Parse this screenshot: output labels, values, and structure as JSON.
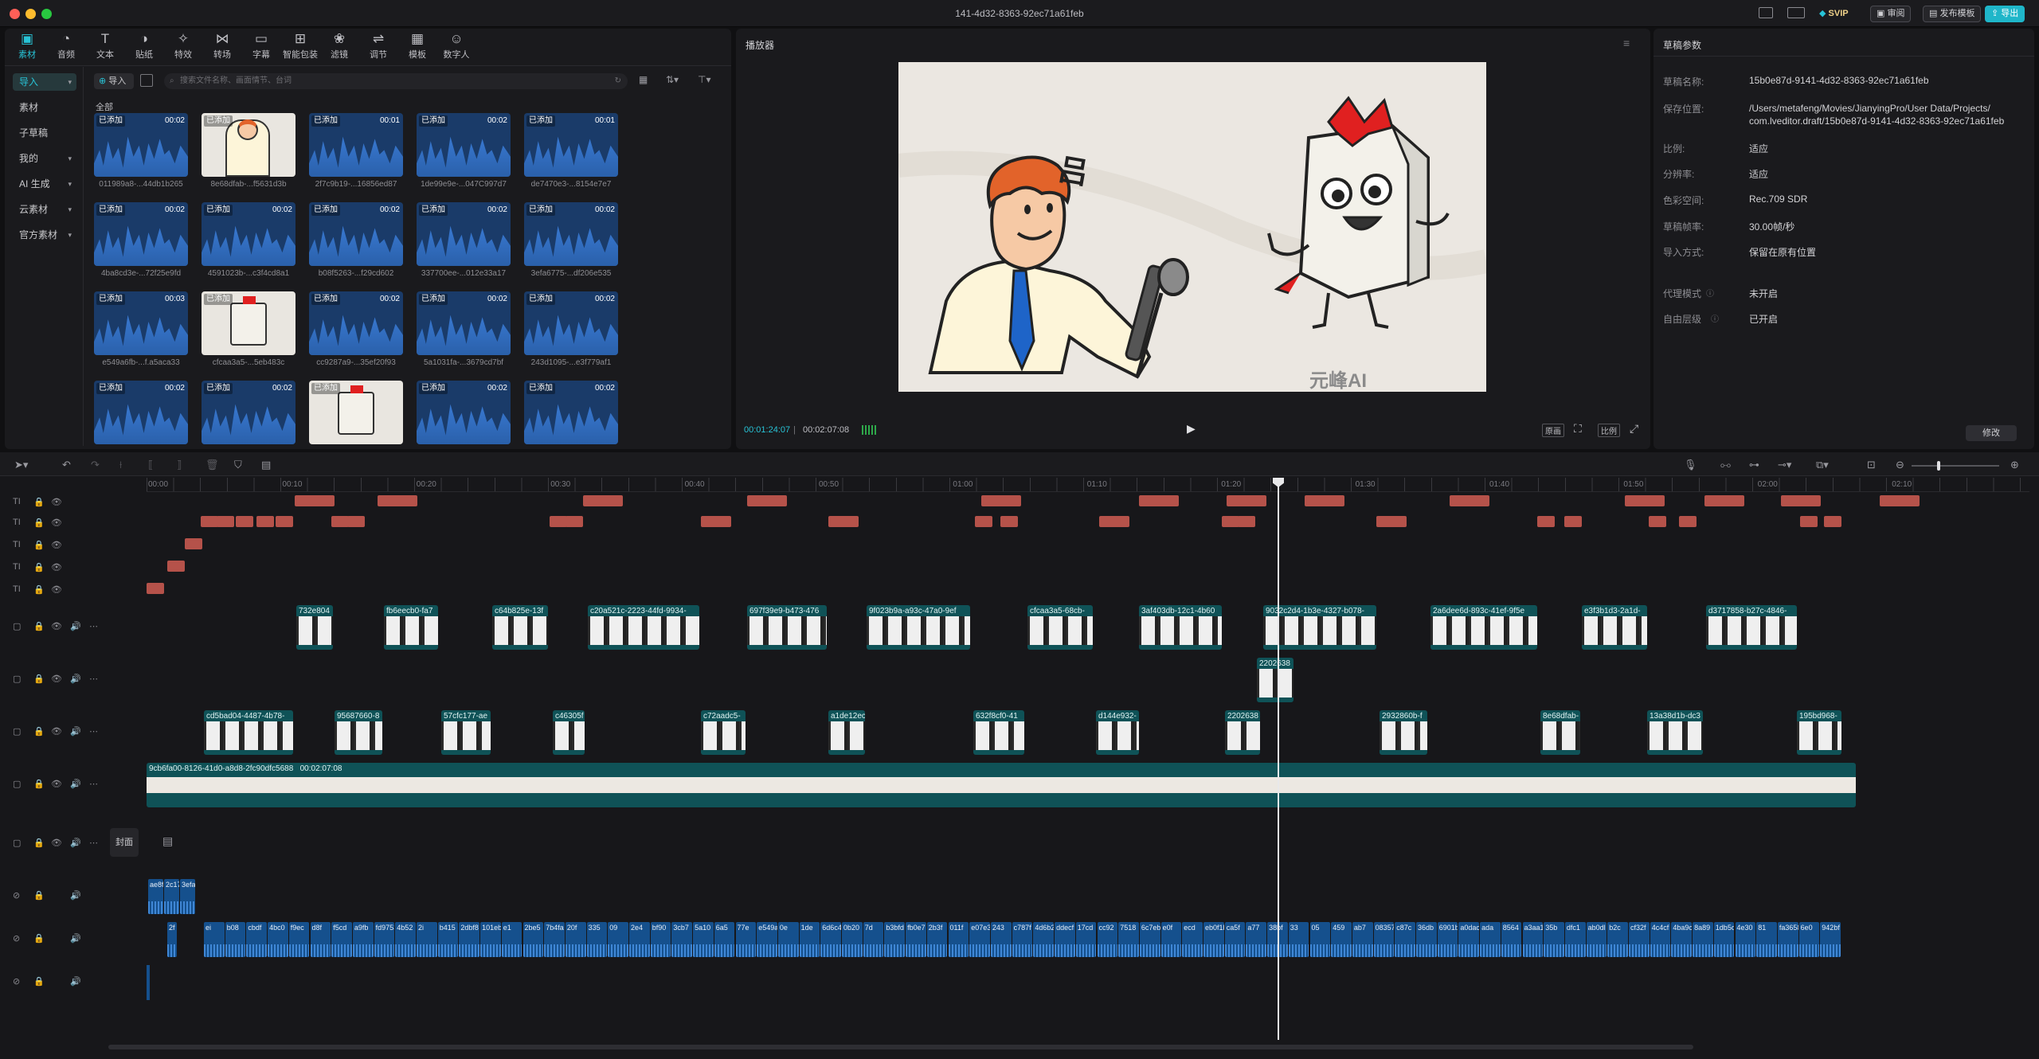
{
  "window": {
    "title": "141-4d32-8363-92ec71a61feb"
  },
  "titlebar_buttons": [
    "SVIP",
    "审阅",
    "发布模板",
    "导出"
  ],
  "toolbar": [
    {
      "label": "素材",
      "icon": "media-icon"
    },
    {
      "label": "音频",
      "icon": "audio-icon"
    },
    {
      "label": "文本",
      "icon": "text-icon"
    },
    {
      "label": "贴纸",
      "icon": "sticker-icon"
    },
    {
      "label": "特效",
      "icon": "effects-icon"
    },
    {
      "label": "转场",
      "icon": "transition-icon"
    },
    {
      "label": "字幕",
      "icon": "subtitle-icon"
    },
    {
      "label": "智能包装",
      "icon": "smart-pack-icon"
    },
    {
      "label": "滤镜",
      "icon": "filter-icon"
    },
    {
      "label": "调节",
      "icon": "adjust-icon"
    },
    {
      "label": "模板",
      "icon": "template-icon"
    },
    {
      "label": "数字人",
      "icon": "digital-human-icon"
    }
  ],
  "sidebar": {
    "items": [
      "导入",
      "素材",
      "子草稿",
      "我的",
      "AI 生成",
      "云素材",
      "官方素材"
    ]
  },
  "media": {
    "import_label": "导入",
    "search_placeholder": "搜索文件名称、画面情节、台词",
    "section_label": "全部",
    "items": [
      {
        "badge": "已添加",
        "duration": "00:02",
        "name": "011989a8-...44db1b265",
        "kind": "wave"
      },
      {
        "badge": "已添加",
        "duration": "",
        "name": "8e68dfab-...f5631d3b",
        "kind": "man"
      },
      {
        "badge": "已添加",
        "duration": "00:01",
        "name": "2f7c9b19-...16856ed87",
        "kind": "wave"
      },
      {
        "badge": "已添加",
        "duration": "00:02",
        "name": "1de99e9e-...047C997d7",
        "kind": "wave"
      },
      {
        "badge": "已添加",
        "duration": "00:01",
        "name": "de7470e3-...8154e7e7",
        "kind": "wave"
      },
      {
        "badge": "已添加",
        "duration": "00:02",
        "name": "4ba8cd3e-...72f25e9fd",
        "kind": "wave"
      },
      {
        "badge": "已添加",
        "duration": "00:02",
        "name": "4591023b-...c3f4cd8a1",
        "kind": "wave"
      },
      {
        "badge": "已添加",
        "duration": "00:02",
        "name": "b08f5263-...f29cd602",
        "kind": "wave"
      },
      {
        "badge": "已添加",
        "duration": "00:02",
        "name": "337700ee-...012e33a17",
        "kind": "wave"
      },
      {
        "badge": "已添加",
        "duration": "00:02",
        "name": "3efa6775-...df206e535",
        "kind": "wave"
      },
      {
        "badge": "已添加",
        "duration": "00:03",
        "name": "e549a6fb-...f.a5aca33",
        "kind": "wave"
      },
      {
        "badge": "已添加",
        "duration": "",
        "name": "cfcaa3a5-...5eb483c",
        "kind": "book"
      },
      {
        "badge": "已添加",
        "duration": "00:02",
        "name": "cc9287a9-...35ef20f93",
        "kind": "wave"
      },
      {
        "badge": "已添加",
        "duration": "00:02",
        "name": "5a1031fa-...3679cd7bf",
        "kind": "wave"
      },
      {
        "badge": "已添加",
        "duration": "00:02",
        "name": "243d1095-...e3f779af1",
        "kind": "wave"
      },
      {
        "badge": "已添加",
        "duration": "00:02",
        "name": "",
        "kind": "wave"
      },
      {
        "badge": "已添加",
        "duration": "00:02",
        "name": "",
        "kind": "wave"
      },
      {
        "badge": "已添加",
        "duration": "",
        "name": "",
        "kind": "book"
      },
      {
        "badge": "已添加",
        "duration": "00:02",
        "name": "",
        "kind": "wave"
      },
      {
        "badge": "已添加",
        "duration": "00:02",
        "name": "",
        "kind": "wave"
      }
    ]
  },
  "player": {
    "title": "播放器",
    "current_time": "00:01:24:07",
    "total_time": "00:02:07:08",
    "watermark": "元峰AI",
    "speech_glyph": "吕",
    "right_controls": [
      "原画",
      "比例"
    ]
  },
  "draft": {
    "title": "草稿参数",
    "props": [
      {
        "k": "草稿名称:",
        "v": "15b0e87d-9141-4d32-8363-92ec71a61feb"
      },
      {
        "k": "保存位置:",
        "v": "/Users/metafeng/Movies/JianyingPro/User Data/Projects/ com.lveditor.draft/15b0e87d-9141-4d32-8363-92ec71a61feb"
      },
      {
        "k": "比例:",
        "v": "适应"
      },
      {
        "k": "分辨率:",
        "v": "适应"
      },
      {
        "k": "色彩空间:",
        "v": "Rec.709 SDR"
      },
      {
        "k": "草稿帧率:",
        "v": "30.00帧/秒"
      },
      {
        "k": "导入方式:",
        "v": "保留在原有位置"
      },
      {
        "k": "代理模式",
        "v": "未开启"
      },
      {
        "k": "自由层级",
        "v": "已开启"
      }
    ],
    "edit_button": "修改"
  },
  "timeline": {
    "ruler": [
      "00:00",
      "00:10",
      "00:20",
      "00:30",
      "00:40",
      "00:50",
      "01:00",
      "01:10",
      "01:20",
      "01:30",
      "01:40",
      "01:50",
      "02:00",
      "02:10"
    ],
    "cover_label": "封面",
    "main_clip_label": "9cb6fa00-8126-41d0-a8d8-2fc90dfc5688",
    "main_clip_duration": "00:02:07:08",
    "playhead_time": "01:24",
    "video_clips_row1": [
      "732e804",
      "fb6eecb0-fa7",
      "c64b825e-13f",
      "c20a521c-2223-44fd-9934-",
      "697f39e9-b473-476",
      "9f023b9a-a93c-47a0-9ef",
      "cfcaa3a5-68cb-",
      "3af403db-12c1-4b60",
      "9032c2d4-1b3e-4327-b078-",
      "2a6dee6d-893c-41ef-9f5e",
      "e3f3b1d3-2a1d-",
      "d3717858-b27c-4846-"
    ],
    "video_clips_row2": [
      "2202638"
    ],
    "video_clips_row3": [
      "cd5bad04-4487-4b78-",
      "95687660-8",
      "57cfc177-ae",
      "c46305f",
      "c72aadc5-",
      "a1de12ec",
      "632f8cf0-41",
      "d144e932-",
      "2202638",
      "2932860b-f",
      "8e68dfab-",
      "13a38d1b-dc3",
      "195bd968-"
    ],
    "audio_row1": [
      "ae8f",
      "2c17",
      "3efa"
    ],
    "audio_row2_first": "2f",
    "audio_row2": [
      "ei",
      "b08",
      "cbdf",
      "4bc0",
      "f9ec",
      "d8f",
      "f5cd",
      "a9fb",
      "fd9753",
      "4b52",
      "2i",
      "b415",
      "2dbf8",
      "101eb",
      "e1",
      "2be5",
      "7b4fa",
      "20f",
      "335",
      "09",
      "2e4",
      "bf90",
      "3cb7",
      "5a10",
      "6a5",
      "77e",
      "e549a6",
      "0e",
      "1de",
      "6d6c4",
      "0b20",
      "7d",
      "b3bfd",
      "fb0e7",
      "2b3f",
      "011f",
      "e07e3",
      "243",
      "c787f",
      "4d6b2",
      "ddecf",
      "17cd",
      "cc92",
      "7518",
      "6c7eb",
      "e0f",
      "ecd",
      "eb0f1b",
      "ca5f",
      "a77",
      "38bf",
      "33",
      "05",
      "459",
      "ab7",
      "08357",
      "c87c",
      "36db",
      "6901b",
      "a0dac",
      "ada",
      "8564",
      "a3aa1",
      "35b",
      "dfc1",
      "ab0dl",
      "b2c",
      "cf32f",
      "4c4cf",
      "4ba9c",
      "8a89",
      "1db5d",
      "4e30",
      "81",
      "fa3658",
      "6e0",
      "942bf"
    ]
  }
}
